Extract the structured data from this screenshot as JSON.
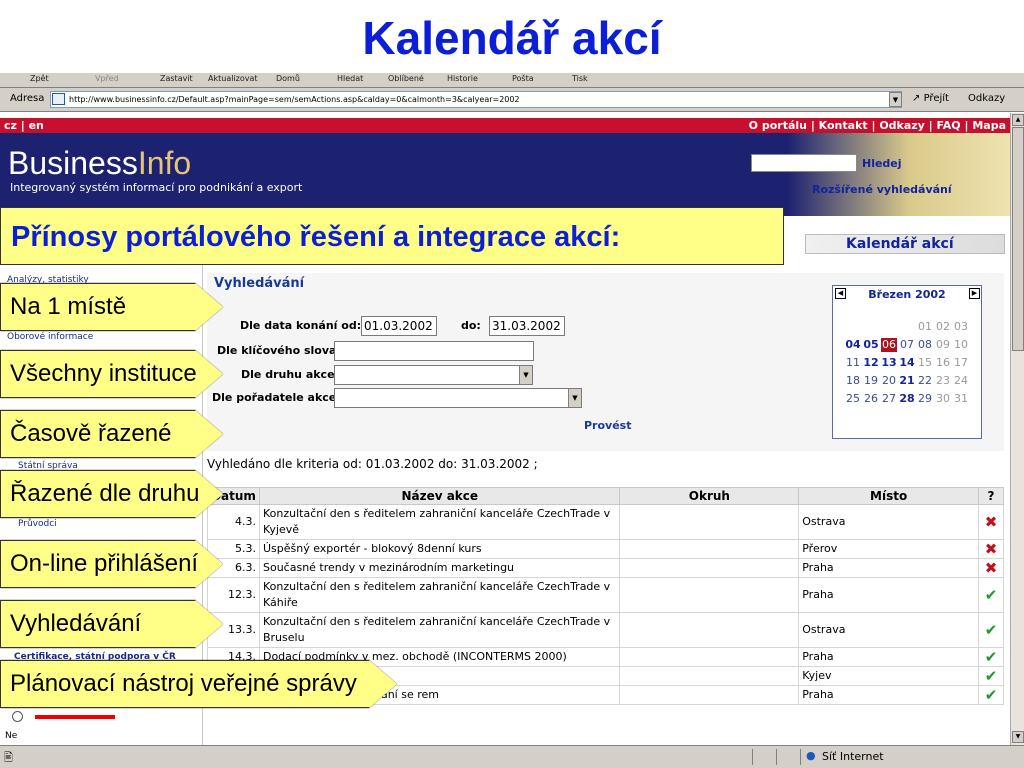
{
  "slide": {
    "title": "Kalendář akcí",
    "subtitle": "Přínosy portálového řešení a integrace akcí:",
    "callouts": [
      "Na 1 místě",
      "Všechny instituce",
      "Časově řazené",
      "Řazené dle druhu",
      "On-line přihlášení",
      "Vyhledávání",
      "Plánovací nástroj veřejné správy"
    ]
  },
  "browser": {
    "toolbar": [
      "Zpět",
      "Vpřed",
      "Zastavit",
      "Aktualizovat",
      "Domů",
      "Hledat",
      "Oblíbené",
      "Historie",
      "Pošta",
      "Tisk"
    ],
    "address_label": "Adresa",
    "url": "http://www.businessinfo.cz/Default.asp?mainPage=sem/semActions.asp&calday=0&calmonth=3&calyear=2002",
    "go": "Přejít",
    "links": "Odkazy",
    "status_zone": "Síť Internet"
  },
  "site": {
    "lang": "cz | en",
    "top_links": "O portálu | Kontakt | Odkazy | FAQ | Mapa",
    "logo_a": "Business",
    "logo_b": "Info",
    "tagline": "Integrovaný systém informací pro podnikání a export",
    "search_button": "Hledej",
    "advanced_search": "Rozšířené vyhledávání",
    "calendar_banner": "Kalendář akcí",
    "left_menu": [
      "Analýzy, statistiky",
      "Oborové informace",
      "Státní správa",
      "Průvodci",
      "Certifikace, státní podpora v ČR",
      "Ne"
    ]
  },
  "search_form": {
    "title": "Vyhledávání",
    "date_label": "Dle data konání od:",
    "date_from": "01.03.2002",
    "date_to_label": "do:",
    "date_to": "31.03.2002",
    "keyword_label": "Dle klíčového slova:",
    "type_label": "Dle druhu akce:",
    "organizer_label": "Dle pořadatele akce:",
    "submit": "Provést"
  },
  "calendar": {
    "month": "Březen 2002",
    "weeks": [
      [
        [
          "",
          ""
        ],
        [
          "",
          ""
        ],
        [
          "",
          ""
        ],
        [
          "",
          ""
        ],
        [
          "01",
          "grey"
        ],
        [
          "02",
          "grey"
        ],
        [
          "03",
          "grey"
        ]
      ],
      [
        [
          "04",
          "bold"
        ],
        [
          "05",
          "bold"
        ],
        [
          "06",
          "sel"
        ],
        [
          "07",
          ""
        ],
        [
          "08",
          ""
        ],
        [
          "09",
          "grey"
        ],
        [
          "10",
          "grey"
        ]
      ],
      [
        [
          "11",
          ""
        ],
        [
          "12",
          "bold"
        ],
        [
          "13",
          "bold"
        ],
        [
          "14",
          "bold"
        ],
        [
          "15",
          "grey"
        ],
        [
          "16",
          "grey"
        ],
        [
          "17",
          "grey"
        ]
      ],
      [
        [
          "18",
          ""
        ],
        [
          "19",
          ""
        ],
        [
          "20",
          ""
        ],
        [
          "21",
          "bold"
        ],
        [
          "22",
          ""
        ],
        [
          "23",
          "grey"
        ],
        [
          "24",
          "grey"
        ]
      ],
      [
        [
          "25",
          ""
        ],
        [
          "26",
          ""
        ],
        [
          "27",
          ""
        ],
        [
          "28",
          "bold"
        ],
        [
          "29",
          ""
        ],
        [
          "30",
          "grey"
        ],
        [
          "31",
          "grey"
        ]
      ]
    ]
  },
  "results": {
    "summary": "Vyhledáno dle kriteria  od: 01.03.2002  do: 31.03.2002 ;",
    "columns": [
      "Datum",
      "Název akce",
      "Okruh",
      "Místo",
      "?"
    ],
    "rows": [
      {
        "date": "4.3.",
        "name": "Konzultační den s ředitelem zahraniční kanceláře CzechTrade v Kyjevě",
        "area": "",
        "place": "Ostrava",
        "ok": false
      },
      {
        "date": "5.3.",
        "name": "Úspěšný exportér - blokový 8denní kurs",
        "area": "",
        "place": "Přerov",
        "ok": false
      },
      {
        "date": "6.3.",
        "name": "Současné trendy v mezinárodním marketingu",
        "area": "",
        "place": "Praha",
        "ok": false
      },
      {
        "date": "12.3.",
        "name": "Konzultační den s ředitelem zahraniční kanceláře CzechTrade v Káhiře",
        "area": "",
        "place": "Praha",
        "ok": true
      },
      {
        "date": "13.3.",
        "name": "Konzultační den s ředitelem zahraniční kanceláře CzechTrade v Bruselu",
        "area": "",
        "place": "Ostrava",
        "ok": true
      },
      {
        "date": "14.3.",
        "name": "Dodací podmínky v mez. obchodě (INCONTERMS 2000)",
        "area": "",
        "place": "Praha",
        "ok": true
      },
      {
        "date": "",
        "name": "a Ukrajině",
        "area": "",
        "place": "Kyjev",
        "ok": true
      },
      {
        "date": "",
        "name": "arní zvyklosti při jednání se rem",
        "area": "",
        "place": "Praha",
        "ok": true
      }
    ]
  },
  "icons": {
    "yes": "✔",
    "no": "✖"
  },
  "colors": {
    "title": "#0b1fd6",
    "callout_bg": "#ffff88",
    "red_bar": "#c8102e",
    "navy": "#1c2270"
  }
}
